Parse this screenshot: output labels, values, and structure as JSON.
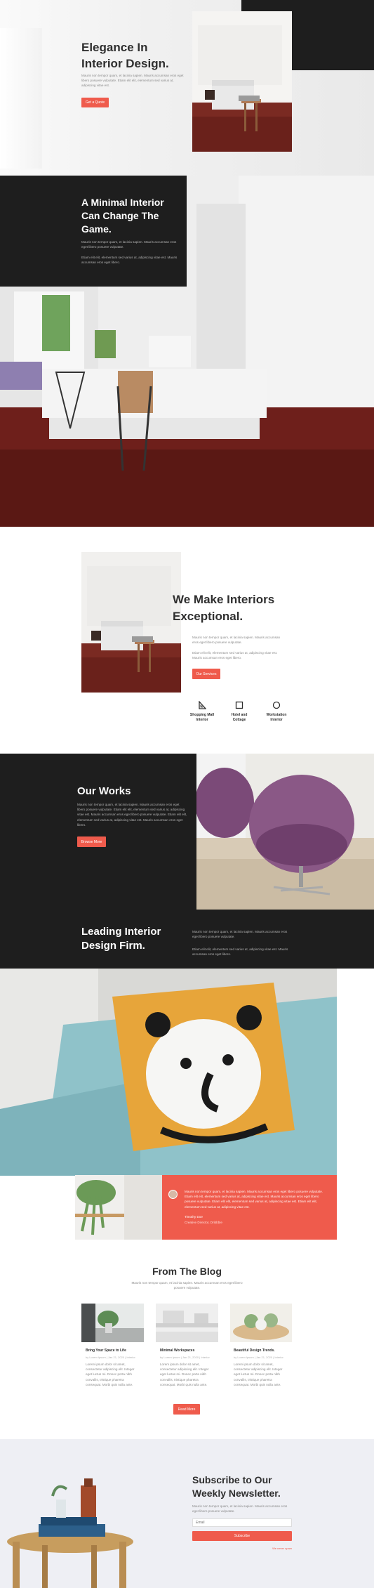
{
  "hero": {
    "title": "Elegance In Interior Design.",
    "text": "Mauris non tempor quam, et lacinia sapien. Mauris accumsan eros eget libero posuere vulputate. Etiam elit elit, elementum sed varius at, adipiscing vitae est.",
    "button": "Get a Quote"
  },
  "minimal": {
    "title": "A Minimal Interior Can Change The Game.",
    "text1": "Mauris non tempor quam, et lacinia sapien. Mauris accumsan eros eget libero posuere vulputate.",
    "text2": "Etiam elit elit, elementum sed varius at, adipiscing vitae est. Mauris accumsan eros eget libero."
  },
  "exceptional": {
    "title": "We Make Interiors Exceptional.",
    "text1": "Mauris non tempor quam, et lacinia sapien. Mauris accumsan eros eget libero posuere vulputate.",
    "text2": "Etiam elit elit, elementum sed varius at, adipiscing vitae est. Mauris accumsan eros eget libero.",
    "button": "Our Services",
    "features": [
      {
        "label": "Shopping Mall Interior",
        "icon": "triangle-ruler-icon"
      },
      {
        "label": "Hotel and Cottage",
        "icon": "square-icon"
      },
      {
        "label": "Workstation Interior",
        "icon": "circle-icon"
      }
    ]
  },
  "works": {
    "title": "Our Works",
    "text": "Mauris non tempor quam, et lacinia sapien. Mauris accumsan eros eget libero posuere vulputate. Etiam elit elit, elementum sed varius at, adipiscing vitae est. Mauris accumsan eros eget libero posuere vulputate. Etiam elit elit, elementum sed varius at, adipiscing vitae est. Mauris accumsan eros eget libero.",
    "button": "Browse More"
  },
  "leading": {
    "title": "Leading Interior Design Firm.",
    "text1": "Mauris non tempor quam, et lacinia sapien. Mauris accumsan eros eget libero posuere vulputate.",
    "text2": "Etiam elit elit, elementum sed varius at, adipiscing vitae est. Mauris accumsan eros eget libero."
  },
  "testimonial": {
    "quote": "Mauris non tempor quam, et lacinia sapien. Mauris accumsan eros eget libero posuere vulputate. Etiam elit elit, elementum sed varius at, adipiscing vitae est. Mauris accumsan eros eget libero posuere vulputate. Etiam elit elit, elementum sed varius at, adipiscing vitae est. Etiam elit elit, elementum sed varius at, adipiscing vitae est.",
    "name": "Timothy Doe",
    "role": "Creative Director, Dribbble"
  },
  "blog": {
    "title": "From The Blog",
    "intro": "Mauris non tempor quam, et lacinia sapien. Mauris accumsan eros eget libero posuere vulputate.",
    "posts": [
      {
        "title": "Bring Your Space to Life",
        "meta": "by Lorem Ipsum | Jan 21, 2020 | Interior",
        "excerpt": "Lorem ipsum dolor sit amet, consectetur adipiscing elit. Integer eget luctus mi. Donec porta nibh convallis, tristique pharetra consequat. Morbi quis nulla ante."
      },
      {
        "title": "Minimal Workspaces",
        "meta": "by Lorem Ipsum | Jan 21, 2020 | Interior",
        "excerpt": "Lorem ipsum dolor sit amet, consectetur adipiscing elit. Integer eget luctus mi. Donec porta nibh convallis, tristique pharetra consequat. Morbi quis nulla ante."
      },
      {
        "title": "Beautiful Design Trends.",
        "meta": "by Lorem Ipsum | Jan 21, 2020 | Interior",
        "excerpt": "Lorem ipsum dolor sit amet, consectetur adipiscing elit. Integer eget luctus mi. Donec porta nibh convallis, tristique pharetra consequat. Morbi quis nulla ante."
      }
    ],
    "button": "Read More"
  },
  "newsletter": {
    "title": "Subscribe to Our Weekly Newsletter.",
    "text": "Mauris non tempor quam, et lacinia sapien. Mauris accumsan eros eget libero posuere vulputate.",
    "placeholder": "Email",
    "button": "Subscribe",
    "link": "We never spam"
  },
  "colors": {
    "accent": "#ef5b4c",
    "dark": "#1e1e1e"
  }
}
